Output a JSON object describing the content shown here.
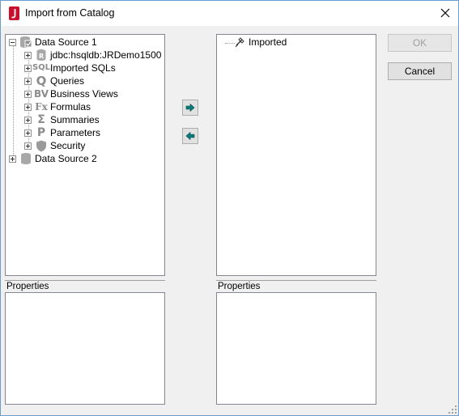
{
  "window": {
    "title": "Import from Catalog"
  },
  "left_tree": {
    "items": [
      {
        "label": "Data Source 1",
        "icon": "database-check-icon",
        "expander": "minus"
      },
      {
        "label": "jdbc:hsqldb:JRDemo1500",
        "icon": "connection-icon",
        "expander": "plus"
      },
      {
        "label": "Imported SQLs",
        "icon": "sql-icon",
        "glyph": "SQL",
        "expander": "plus"
      },
      {
        "label": "Queries",
        "icon": "query-icon",
        "glyph": "Q",
        "expander": "plus"
      },
      {
        "label": "Business Views",
        "icon": "business-view-icon",
        "glyph": "BV",
        "expander": "plus"
      },
      {
        "label": "Formulas",
        "icon": "formula-icon",
        "glyph": "Fx",
        "expander": "plus"
      },
      {
        "label": "Summaries",
        "icon": "sigma-icon",
        "glyph": "Σ",
        "expander": "plus"
      },
      {
        "label": "Parameters",
        "icon": "parameter-icon",
        "glyph": "P",
        "expander": "plus"
      },
      {
        "label": "Security",
        "icon": "shield-icon",
        "expander": "plus"
      },
      {
        "label": "Data Source 2",
        "icon": "database-icon",
        "expander": "plus"
      }
    ]
  },
  "right_tree": {
    "items": [
      {
        "label": "Imported",
        "icon": "imported-catalog-icon"
      }
    ]
  },
  "properties": {
    "left_label": "Properties",
    "right_label": "Properties"
  },
  "buttons": {
    "ok": "OK",
    "cancel": "Cancel",
    "add_icon": "arrow-right-icon",
    "remove_icon": "arrow-left-icon"
  },
  "colors": {
    "arrow": "#0a7a7a",
    "app_icon": "#c8102e"
  }
}
